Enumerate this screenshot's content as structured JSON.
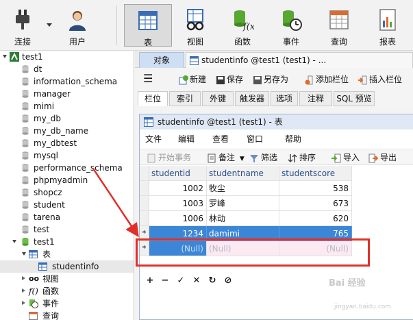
{
  "toolbar": {
    "buttons": [
      {
        "label": "连接",
        "icon": "plug-icon"
      },
      {
        "label": "用户",
        "icon": "user-icon"
      },
      {
        "label": "表",
        "icon": "table-icon"
      },
      {
        "label": "视图",
        "icon": "view-glasses-icon"
      },
      {
        "label": "函数",
        "icon": "function-icon"
      },
      {
        "label": "事件",
        "icon": "event-clock-icon"
      },
      {
        "label": "查询",
        "icon": "query-icon"
      },
      {
        "label": "报表",
        "icon": "report-icon"
      }
    ],
    "active": "表"
  },
  "tree": {
    "connection": "test1",
    "databases": [
      "dt",
      "information_schema",
      "manager",
      "mimi",
      "my_db",
      "my_db_name",
      "my_dbtest",
      "mysql",
      "performance_schema",
      "phpmyadmin",
      "shopcz",
      "student",
      "tarena",
      "test"
    ],
    "open_db": "test1",
    "open_db_children": {
      "tables_label": "表",
      "table": "studentinfo",
      "views": "视图",
      "functions": "函数",
      "events": "事件",
      "queries": "查询"
    }
  },
  "tabs": {
    "objects": "对象",
    "table_tab": "studentinfo @test1 (test1) - ..."
  },
  "object_toolbar": {
    "new": "新建",
    "save": "保存",
    "save_as": "另存为",
    "add_field": "添加栏位",
    "insert_field": "插入栏位"
  },
  "sub_tabs": [
    "栏位",
    "索引",
    "外键",
    "触发器",
    "选项",
    "注释",
    "SQL 预览"
  ],
  "window": {
    "title": "studentinfo @test1 (test1) - 表",
    "menu": [
      "文件",
      "编辑",
      "查看",
      "窗口",
      "帮助"
    ],
    "grid_toolbar": {
      "begin_txn": "开始事务",
      "memo": "备注",
      "filter": "筛选",
      "sort": "排序",
      "import": "导入",
      "export": "导出"
    },
    "columns": [
      "studentid",
      "studentname",
      "studentscore"
    ],
    "rows": [
      {
        "id": "1002",
        "name": "牧尘",
        "score": "538"
      },
      {
        "id": "1003",
        "name": "罗峰",
        "score": "673"
      },
      {
        "id": "1006",
        "name": "林动",
        "score": "620"
      },
      {
        "id": "1234",
        "name": "damimi",
        "score": "765"
      }
    ],
    "null_row": {
      "id": "(Null)",
      "name": "(Null)",
      "score": "(Null)"
    },
    "row_marker": "*",
    "nav": [
      "+",
      "−",
      "✓",
      "✕",
      "↻",
      "⊘"
    ]
  },
  "watermark": {
    "text": "Bai 经验",
    "url": "jingyan.baidu.com"
  },
  "colors": {
    "accent": "#3b86d6",
    "highlight": "#e0302a",
    "null_row": "#fbeaf2"
  }
}
